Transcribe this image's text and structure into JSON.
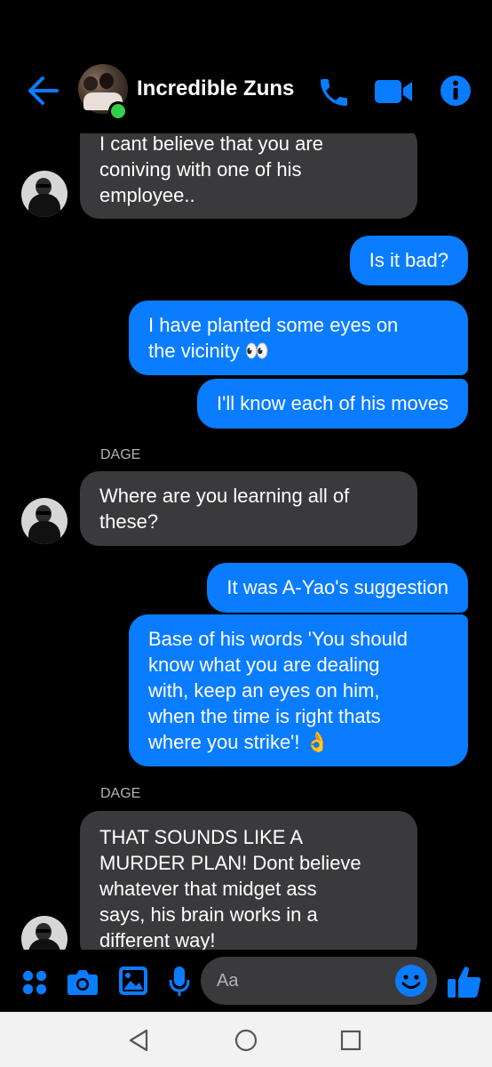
{
  "header": {
    "title": "Incredible Zuns"
  },
  "messages": [
    {
      "side": "in",
      "lines": [
        "I cant believe that you are",
        "coniving with one of his",
        "employee.."
      ]
    },
    {
      "side": "out",
      "lines": [
        "Is it bad?"
      ]
    },
    {
      "side": "out",
      "lines": [
        "I have planted some eyes on",
        "the vicinity 👀"
      ]
    },
    {
      "side": "out",
      "lines": [
        "I'll know each of his moves"
      ]
    },
    {
      "sender": "DAGE"
    },
    {
      "side": "in",
      "lines": [
        "Where are you learning all of",
        "these?"
      ]
    },
    {
      "side": "out",
      "lines": [
        "It was A-Yao's suggestion"
      ]
    },
    {
      "side": "out",
      "lines": [
        "Base of his words 'You should",
        "know what you are dealing",
        "with, keep an eyes on him,",
        "when the time is right thats",
        "where you strike'! 👌"
      ]
    },
    {
      "sender": "DAGE"
    },
    {
      "side": "in",
      "lines": [
        "THAT SOUNDS LIKE A",
        "MURDER PLAN! Dont believe",
        "whatever that midget ass",
        "says, his brain works in a",
        "different way!"
      ]
    }
  ],
  "composer": {
    "placeholder": "Aa"
  },
  "icons": {
    "back": "back-arrow-icon",
    "call": "phone-icon",
    "video": "video-camera-icon",
    "info": "info-icon",
    "apps": "apps-grid-icon",
    "camera": "camera-icon",
    "gallery": "image-icon",
    "mic": "microphone-icon",
    "emoji": "emoji-icon",
    "like": "thumbs-up-icon"
  },
  "colors": {
    "accent": "#0a7cff",
    "incoming": "#3a3a3c",
    "background": "#000000",
    "online": "#31d04a"
  }
}
